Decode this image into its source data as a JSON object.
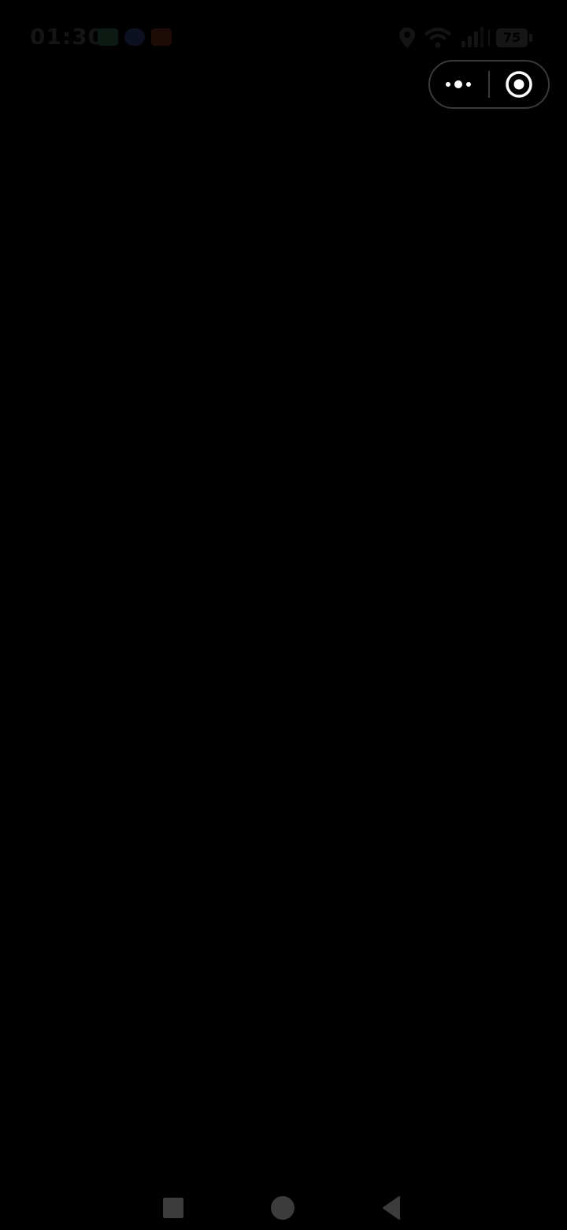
{
  "status_bar": {
    "time": "01:30",
    "battery": "75",
    "icons": [
      "location-icon",
      "wifi-icon",
      "signal-icon"
    ],
    "notification_icons": [
      "app-notification-icon",
      "message-notification-icon",
      "app-notification-icon"
    ]
  },
  "capsule": {
    "more_icon": "more-dots-icon",
    "close_icon": "close-target-icon"
  },
  "nav_bar": {
    "recent_icon": "square-icon",
    "home_icon": "circle-icon",
    "back_icon": "triangle-back-icon"
  },
  "colors": {
    "background": "#000000",
    "capsule_border": "#3a3a3a",
    "nav_icon": "#3c3c3c",
    "dimmed_status": "#151515"
  }
}
